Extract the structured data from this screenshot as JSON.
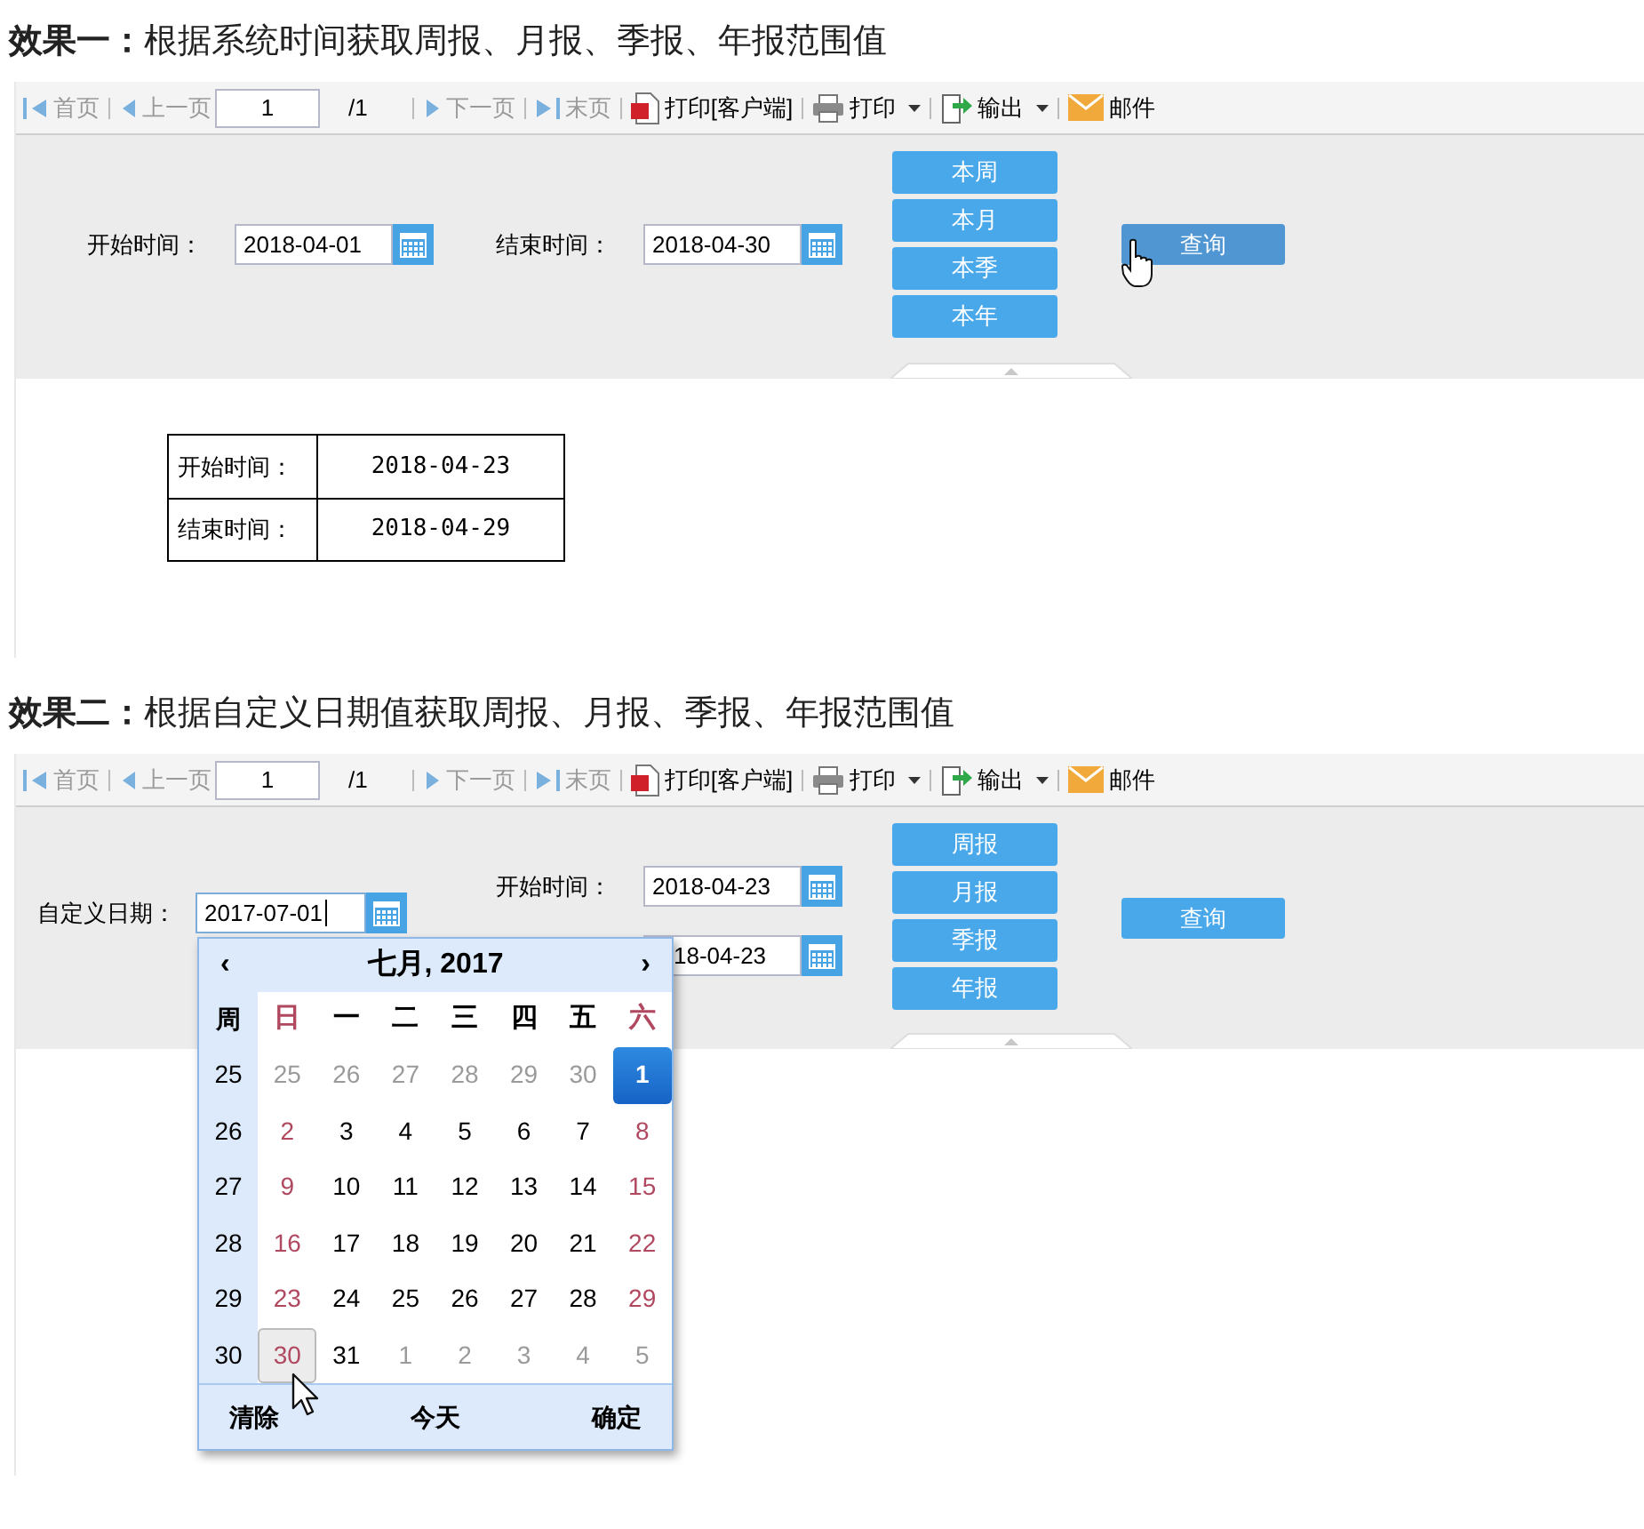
{
  "sections": [
    {
      "heading": "**效果一：**根据系统时间获取周报、月报、季报、年报范围值",
      "toolbar": [
        {
          "kind": "first",
          "label": "首页",
          "disabled": true
        },
        {
          "kind": "prev",
          "label": "上一页",
          "disabled": true
        },
        {
          "kind": "page",
          "value": "1"
        },
        {
          "kind": "total",
          "label": "/1"
        },
        {
          "kind": "next",
          "label": "下一页",
          "disabled": true
        },
        {
          "kind": "last",
          "label": "末页",
          "disabled": true
        },
        {
          "kind": "pdf",
          "label": "打印[客户端]"
        },
        {
          "kind": "print",
          "label": "打印",
          "dropdown": true
        },
        {
          "kind": "export",
          "label": "输出",
          "dropdown": true
        },
        {
          "kind": "mail",
          "label": "邮件"
        }
      ],
      "params": {
        "fields": [
          {
            "label": "开始时间：",
            "value": "2018-04-01"
          },
          {
            "label": "结束时间：",
            "value": "2018-04-30"
          }
        ],
        "period_buttons": [
          "本周",
          "本月",
          "本季",
          "本年"
        ],
        "query": {
          "label": "查询",
          "hovered": true
        }
      },
      "report": [
        {
          "label": "开始时间：",
          "value": "2018-04-23"
        },
        {
          "label": "结束时间：",
          "value": "2018-04-29"
        }
      ]
    },
    {
      "heading": "**效果二：**根据自定义日期值获取周报、月报、季报、年报范围值",
      "toolbar": [
        {
          "kind": "first",
          "label": "首页",
          "disabled": true
        },
        {
          "kind": "prev",
          "label": "上一页",
          "disabled": true
        },
        {
          "kind": "page",
          "value": "1"
        },
        {
          "kind": "total",
          "label": "/1"
        },
        {
          "kind": "next",
          "label": "下一页",
          "disabled": true
        },
        {
          "kind": "last",
          "label": "末页",
          "disabled": true
        },
        {
          "kind": "pdf",
          "label": "打印[客户端]"
        },
        {
          "kind": "print",
          "label": "打印",
          "dropdown": true
        },
        {
          "kind": "export",
          "label": "输出",
          "dropdown": true
        },
        {
          "kind": "mail",
          "label": "邮件"
        }
      ],
      "params": {
        "custom_date": {
          "label": "自定义日期：",
          "value": "2017-07-01",
          "focused": true
        },
        "fields": [
          {
            "label": "开始时间：",
            "value": "2018-04-23"
          },
          {
            "value": "18-04-23",
            "covered": true
          }
        ],
        "period_buttons": [
          "周报",
          "月报",
          "季报",
          "年报"
        ],
        "query": {
          "label": "查询",
          "hovered": false
        }
      },
      "calendar": {
        "prev": "‹",
        "title": "七月, 2017",
        "next": "›",
        "week_header": "周",
        "weekdays": [
          "日",
          "一",
          "二",
          "三",
          "四",
          "五",
          "六"
        ],
        "weeks": [
          {
            "number": "25",
            "days": [
              {
                "label": "25",
                "muted": true,
                "selected": false,
                "hovered": false
              },
              {
                "label": "26",
                "muted": true,
                "selected": false,
                "hovered": false
              },
              {
                "label": "27",
                "muted": true,
                "selected": false,
                "hovered": false
              },
              {
                "label": "28",
                "muted": true,
                "selected": false,
                "hovered": false
              },
              {
                "label": "29",
                "muted": true,
                "selected": false,
                "hovered": false
              },
              {
                "label": "30",
                "muted": true,
                "selected": false,
                "hovered": false
              },
              {
                "label": "1",
                "muted": false,
                "selected": true,
                "hovered": false
              }
            ]
          },
          {
            "number": "26",
            "days": [
              {
                "label": "2",
                "muted": false,
                "selected": false,
                "hovered": false
              },
              {
                "label": "3",
                "muted": false,
                "selected": false,
                "hovered": false
              },
              {
                "label": "4",
                "muted": false,
                "selected": false,
                "hovered": false
              },
              {
                "label": "5",
                "muted": false,
                "selected": false,
                "hovered": false
              },
              {
                "label": "6",
                "muted": false,
                "selected": false,
                "hovered": false
              },
              {
                "label": "7",
                "muted": false,
                "selected": false,
                "hovered": false
              },
              {
                "label": "8",
                "muted": false,
                "selected": false,
                "hovered": false
              }
            ]
          },
          {
            "number": "27",
            "days": [
              {
                "label": "9",
                "muted": false,
                "selected": false,
                "hovered": false
              },
              {
                "label": "10",
                "muted": false,
                "selected": false,
                "hovered": false
              },
              {
                "label": "11",
                "muted": false,
                "selected": false,
                "hovered": false
              },
              {
                "label": "12",
                "muted": false,
                "selected": false,
                "hovered": false
              },
              {
                "label": "13",
                "muted": false,
                "selected": false,
                "hovered": false
              },
              {
                "label": "14",
                "muted": false,
                "selected": false,
                "hovered": false
              },
              {
                "label": "15",
                "muted": false,
                "selected": false,
                "hovered": false
              }
            ]
          },
          {
            "number": "28",
            "days": [
              {
                "label": "16",
                "muted": false,
                "selected": false,
                "hovered": false
              },
              {
                "label": "17",
                "muted": false,
                "selected": false,
                "hovered": false
              },
              {
                "label": "18",
                "muted": false,
                "selected": false,
                "hovered": false
              },
              {
                "label": "19",
                "muted": false,
                "selected": false,
                "hovered": false
              },
              {
                "label": "20",
                "muted": false,
                "selected": false,
                "hovered": false
              },
              {
                "label": "21",
                "muted": false,
                "selected": false,
                "hovered": false
              },
              {
                "label": "22",
                "muted": false,
                "selected": false,
                "hovered": false
              }
            ]
          },
          {
            "number": "29",
            "days": [
              {
                "label": "23",
                "muted": false,
                "selected": false,
                "hovered": false
              },
              {
                "label": "24",
                "muted": false,
                "selected": false,
                "hovered": false
              },
              {
                "label": "25",
                "muted": false,
                "selected": false,
                "hovered": false
              },
              {
                "label": "26",
                "muted": false,
                "selected": false,
                "hovered": false
              },
              {
                "label": "27",
                "muted": false,
                "selected": false,
                "hovered": false
              },
              {
                "label": "28",
                "muted": false,
                "selected": false,
                "hovered": false
              },
              {
                "label": "29",
                "muted": false,
                "selected": false,
                "hovered": false
              }
            ]
          },
          {
            "number": "30",
            "days": [
              {
                "label": "30",
                "muted": false,
                "selected": false,
                "hovered": true
              },
              {
                "label": "31",
                "muted": false,
                "selected": false,
                "hovered": false
              },
              {
                "label": "1",
                "muted": true,
                "selected": false,
                "hovered": false
              },
              {
                "label": "2",
                "muted": true,
                "selected": false,
                "hovered": false
              },
              {
                "label": "3",
                "muted": true,
                "selected": false,
                "hovered": false
              },
              {
                "label": "4",
                "muted": true,
                "selected": false,
                "hovered": false
              },
              {
                "label": "5",
                "muted": true,
                "selected": false,
                "hovered": false
              }
            ]
          }
        ],
        "footer": [
          "清除",
          "今天",
          "确定"
        ]
      }
    }
  ]
}
